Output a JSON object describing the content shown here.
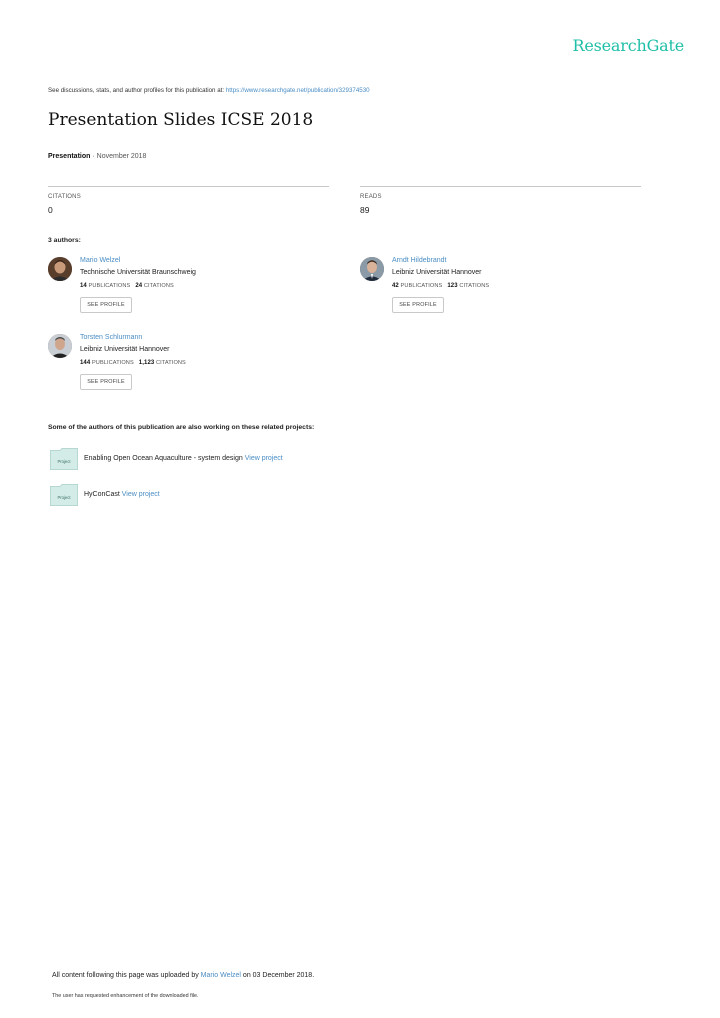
{
  "brand": "ResearchGate",
  "source": {
    "prefix": "See discussions, stats, and author profiles for this publication at: ",
    "url": "https://www.researchgate.net/publication/329374530"
  },
  "title": "Presentation Slides ICSE 2018",
  "meta": {
    "type": "Presentation",
    "separator": " · ",
    "date": "November 2018"
  },
  "stats": {
    "citations_label": "CITATIONS",
    "citations_value": "0",
    "reads_label": "READS",
    "reads_value": "89"
  },
  "authors_heading": "3 authors:",
  "authors": [
    {
      "name": "Mario Welzel",
      "institution": "Technische Universität Braunschweig",
      "publications": "14",
      "publications_label": "PUBLICATIONS",
      "citations": "24",
      "citations_label": "CITATIONS",
      "button": "SEE PROFILE"
    },
    {
      "name": "Arndt Hildebrandt",
      "institution": "Leibniz Universität Hannover",
      "publications": "42",
      "publications_label": "PUBLICATIONS",
      "citations": "123",
      "citations_label": "CITATIONS",
      "button": "SEE PROFILE"
    },
    {
      "name": "Torsten Schlurmann",
      "institution": "Leibniz Universität Hannover",
      "publications": "144",
      "publications_label": "PUBLICATIONS",
      "citations": "1,123",
      "citations_label": "CITATIONS",
      "button": "SEE PROFILE"
    }
  ],
  "related_heading": "Some of the authors of this publication are also working on these related projects:",
  "projects": [
    {
      "icon_label": "Project",
      "name": "Enabling Open Ocean Aquaculture - system design",
      "link": "View project"
    },
    {
      "icon_label": "Project",
      "name": "HyConCast",
      "link": "View project"
    }
  ],
  "footer": {
    "upload_prefix": "All content following this page was uploaded by ",
    "uploader": "Mario Welzel",
    "upload_suffix": " on 03 December 2018.",
    "note": "The user has requested enhancement of the downloaded file."
  },
  "colors": {
    "brand": "#1fbfa8",
    "link": "#4a8dc4",
    "folder_fill": "#d4ece8",
    "folder_stroke": "#b7d8d2"
  }
}
